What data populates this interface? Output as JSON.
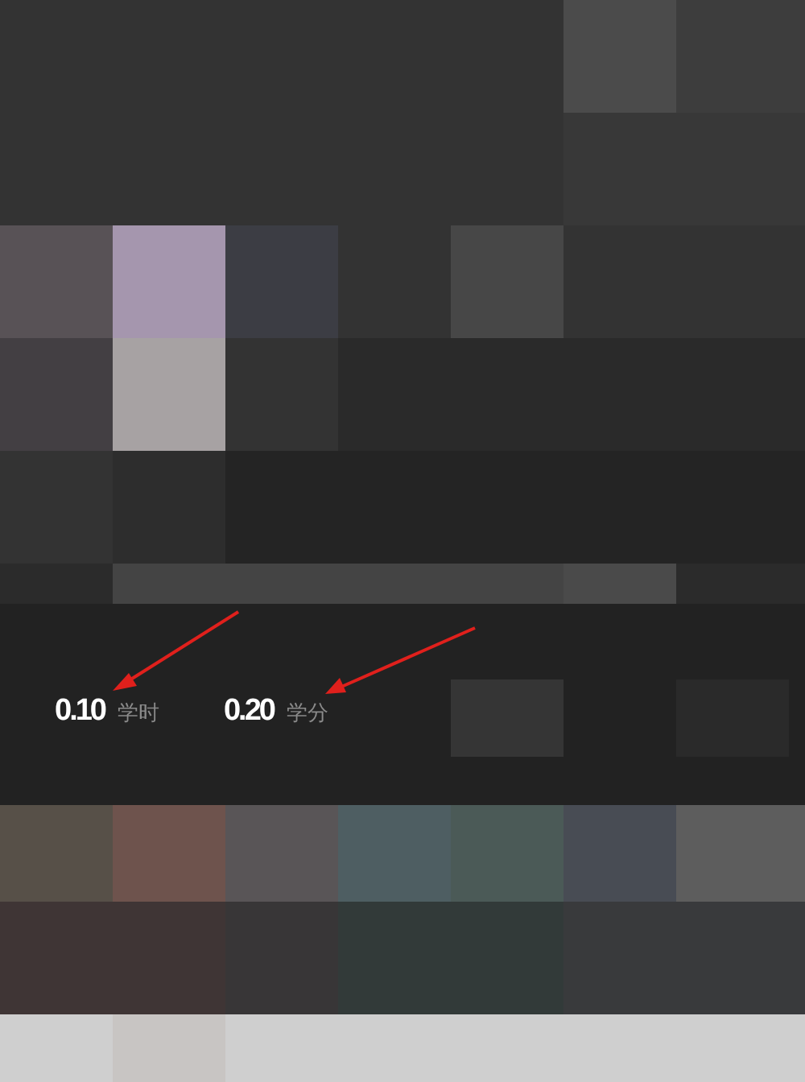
{
  "stats": [
    {
      "value": "0.10",
      "unit": "学时"
    },
    {
      "value": "0.20",
      "unit": "学分"
    }
  ]
}
